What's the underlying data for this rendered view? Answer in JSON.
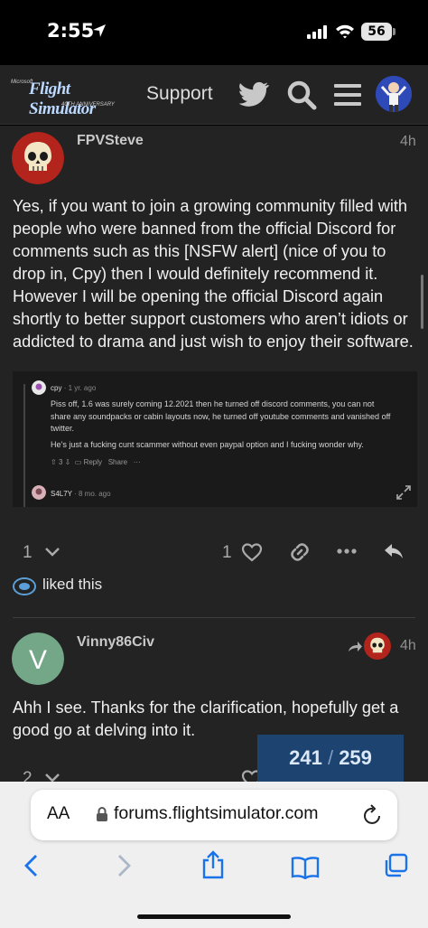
{
  "status_bar": {
    "time": "2:55",
    "battery": "56"
  },
  "header": {
    "logo_small": "Microsoft",
    "logo_main": "Flight Simulator",
    "logo_sub": "40TH ANNIVERSARY",
    "nav_label": "Support",
    "icons": [
      "twitter-icon",
      "search-icon",
      "menu-icon",
      "user-avatar"
    ]
  },
  "posts": [
    {
      "username": "FPVSteve",
      "time": "4h",
      "body": "Yes, if you want to join a growing community filled with people who were banned from the official Discord for comments such as this [NSFW alert] (nice of you to drop in, Cpy) then I would definitely recommend it. However I will be opening the official Discord again shortly to better support customers who aren’t idiots or addicted to drama and just wish to enjoy their software.",
      "embed": {
        "comment1_user": "cpy",
        "comment1_ago": "· 1 yr. ago",
        "comment1_p1": "Piss off, 1.6 was surely coming 12.2021 then he turned off discord comments, you can not share any soundpacks or cabin layouts now, he turned off youtube comments and vanished off twitter.",
        "comment1_p2": "He’s just a fucking cunt scammer without even paypal option and I fucking wonder why.",
        "votes": "3",
        "reply": "Reply",
        "share": "Share",
        "more": "···",
        "comment2_user": "S4L7Y",
        "comment2_ago": "· 8 mo. ago"
      },
      "replies_count": "1",
      "likes_count": "1",
      "liked_text": "liked this"
    },
    {
      "username": "Vinny86Civ",
      "avatar_letter": "V",
      "time": "4h",
      "body": "Ahh I see. Thanks for the clarification, hopefully get a good go at delving into it.",
      "replies_count": "2"
    }
  ],
  "progress": {
    "current": "241",
    "separator": "/",
    "total": "259"
  },
  "browser": {
    "aa_label": "AA",
    "url": "forums.flightsimulator.com"
  },
  "colors": {
    "header_bg": "#232323",
    "progress_bg": "#1d4371",
    "avatar_v": "#74a688",
    "skull_red": "#b3241c"
  }
}
